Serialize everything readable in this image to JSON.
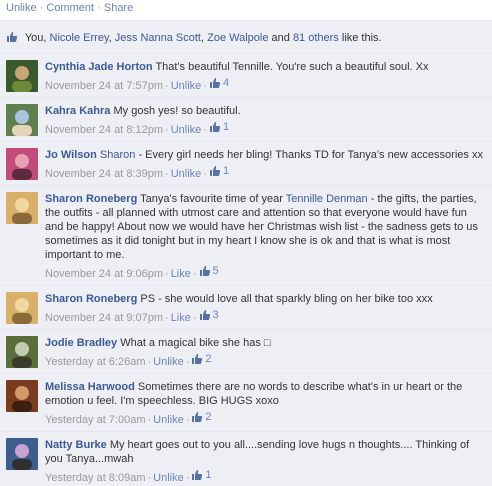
{
  "actions": {
    "unlike": "Unlike",
    "comment": "Comment",
    "share": "Share"
  },
  "likes": {
    "you": "You, ",
    "names": [
      "Nicole Errey",
      "Jess Nanna Scott",
      "Zoe Walpole"
    ],
    "and": " and ",
    "others": "81 others",
    "suffix": " like this."
  },
  "colors": {
    "link": "#3b5998",
    "panel": "#edeff4",
    "meta": "#999999"
  },
  "comments": [
    {
      "author": "Cynthia Jade Horton",
      "tag": "",
      "text": "That's beautiful Tennille. You're such a beautiful soul. Xx",
      "time": "November 24 at 7:57pm",
      "action": "Unlike",
      "likes": "4"
    },
    {
      "author": "Kahra Kahra",
      "tag": "",
      "text": "My gosh yes! so beautiful.",
      "time": "November 24 at 8:12pm",
      "action": "Unlike",
      "likes": "1"
    },
    {
      "author": "Jo Wilson",
      "tag": "Sharon",
      "text": " - Every girl needs her bling! Thanks TD for Tanya's new accessories xx",
      "time": "November 24 at 8:39pm",
      "action": "Unlike",
      "likes": "1"
    },
    {
      "author": "Sharon Roneberg",
      "tag": "",
      "text": "Tanya's favourite time of year ",
      "tag2": "Tennille Denman",
      "text2": " - the gifts, the parties, the outfits - all planned with utmost care and attention so that everyone would have fun and be happy! About now we would have her Christmas wish list - the sadness gets to us sometimes as it did tonight but in my heart I know she is ok and that is what is most important to me.",
      "time": "November 24 at 9:06pm",
      "action": "Like",
      "likes": "5"
    },
    {
      "author": "Sharon Roneberg",
      "tag": "",
      "text": "PS - she would love all that sparkly bling on her bike too xxx",
      "time": "November 24 at 9:07pm",
      "action": "Like",
      "likes": "3"
    },
    {
      "author": "Jodie Bradley",
      "tag": "",
      "text": "What a magical bike she has □",
      "time": "Yesterday at 6:26am",
      "action": "Unlike",
      "likes": "2"
    },
    {
      "author": "Melissa Harwood",
      "tag": "",
      "text": "Sometimes there are no words to describe what's in ur heart or the emotion u feel. I'm speechless. BIG HUGS xoxo",
      "time": "Yesterday at 7:00am",
      "action": "Unlike",
      "likes": "2"
    },
    {
      "author": "Natty Burke",
      "tag": "",
      "text": "My heart goes out to you all....sending love hugs n thoughts.... Thinking of you Tanya...mwah",
      "time": "Yesterday at 8:09am",
      "action": "Unlike",
      "likes": "1"
    }
  ]
}
